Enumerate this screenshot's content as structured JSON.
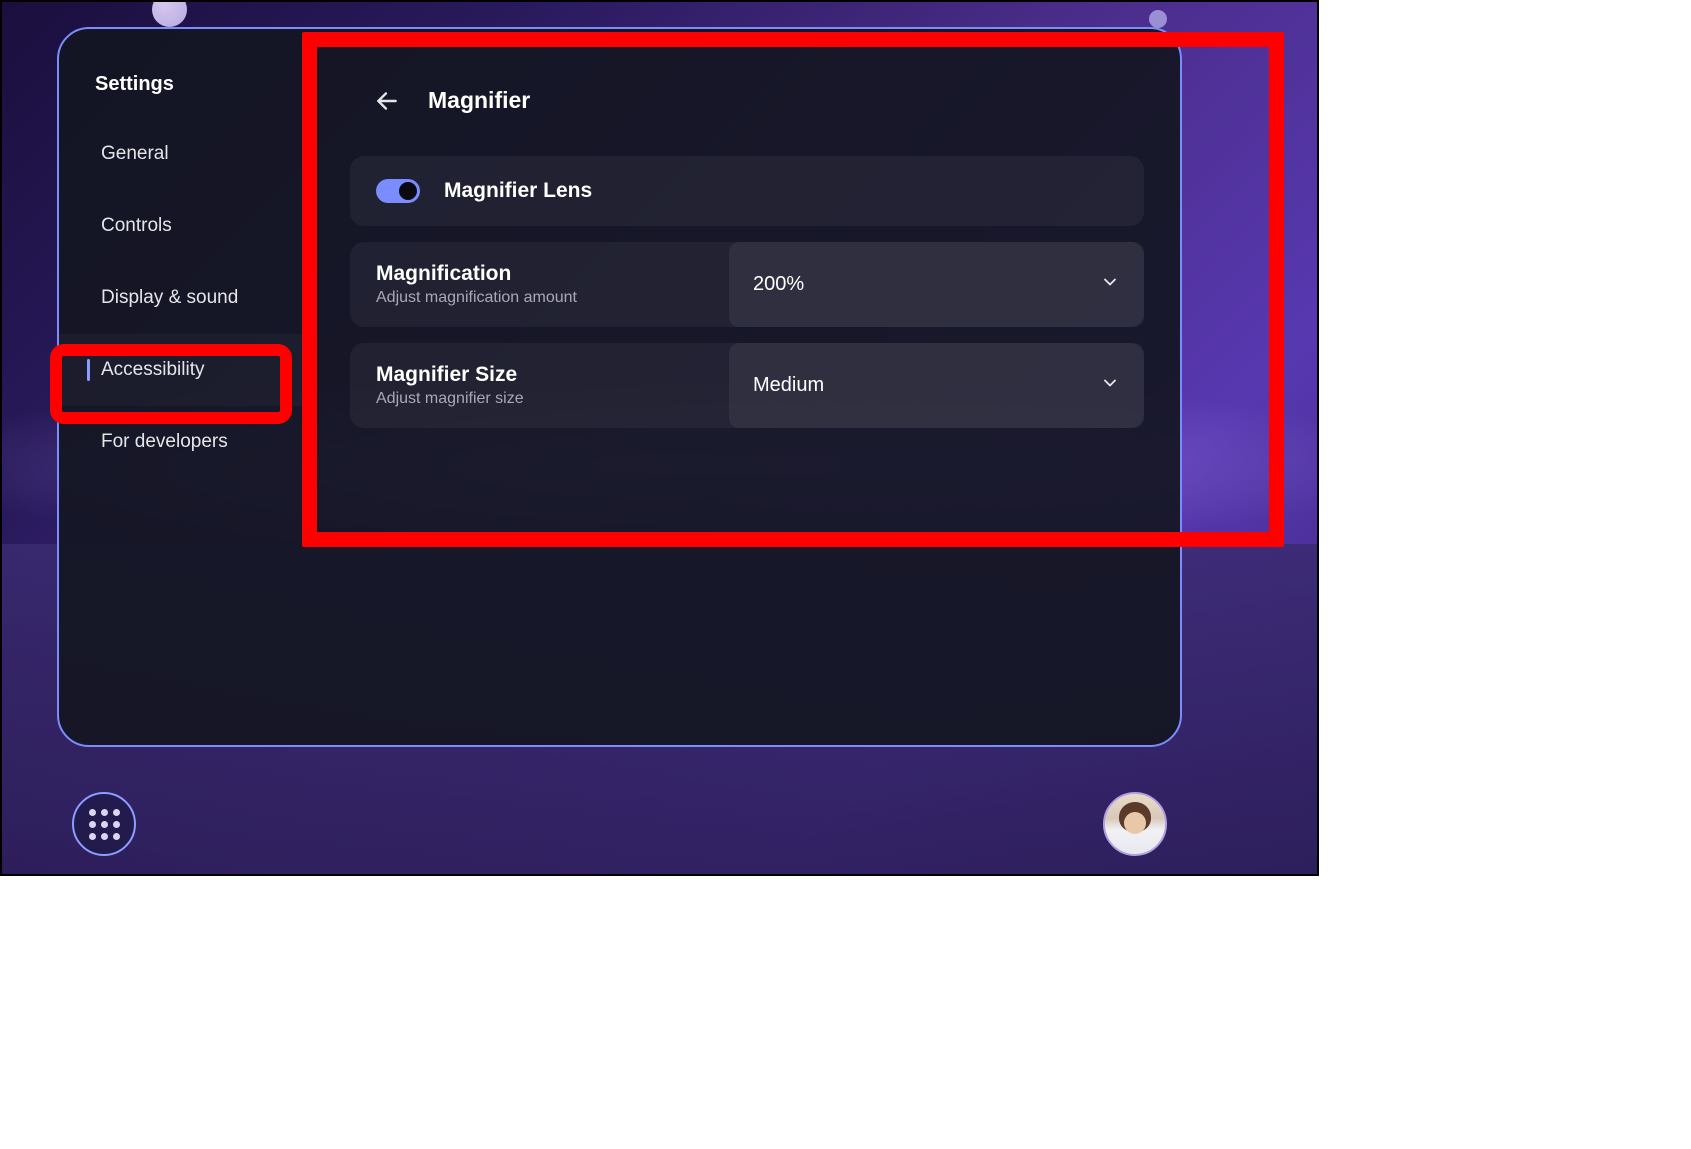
{
  "sidebar": {
    "title": "Settings",
    "items": [
      {
        "label": "General"
      },
      {
        "label": "Controls"
      },
      {
        "label": "Display & sound"
      },
      {
        "label": "Accessibility"
      },
      {
        "label": "For developers"
      }
    ],
    "active_index": 3
  },
  "content": {
    "title": "Magnifier",
    "toggle": {
      "label": "Magnifier Lens",
      "on": true
    },
    "settings": [
      {
        "name": "Magnification",
        "desc": "Adjust magnification amount",
        "value": "200%"
      },
      {
        "name": "Magnifier Size",
        "desc": "Adjust magnifier size",
        "value": "Medium"
      }
    ]
  },
  "colors": {
    "accent": "#7b8cff",
    "highlight": "#ff0000"
  }
}
